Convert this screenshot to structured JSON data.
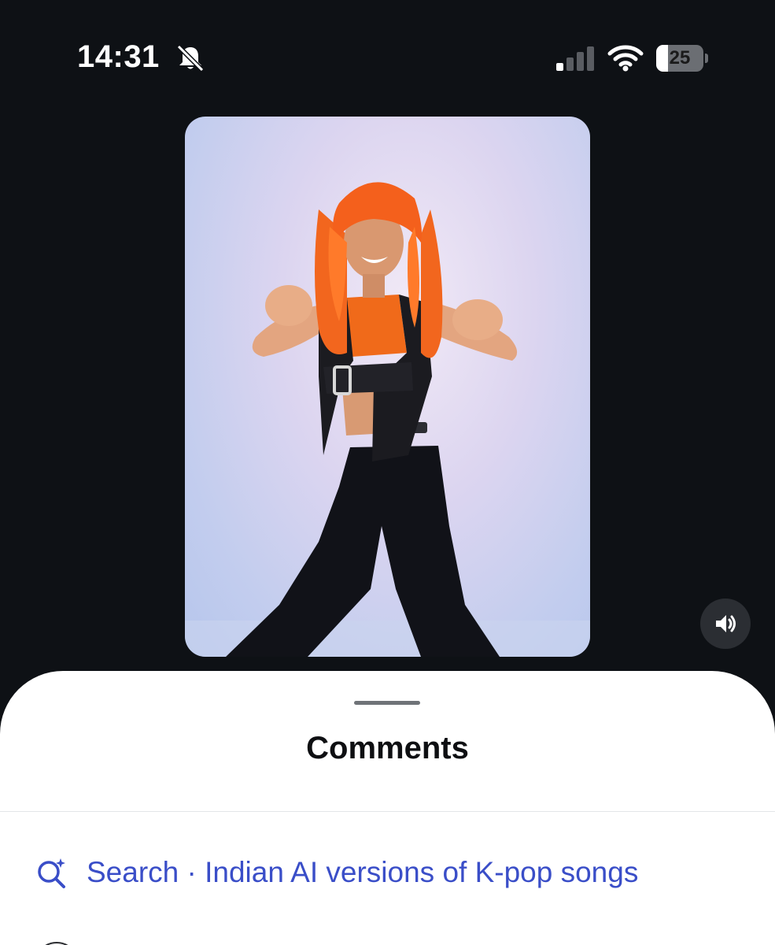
{
  "status_bar": {
    "time": "14:31",
    "silent_icon": "bell-slash-icon",
    "signal_icon": "cellular-signal-icon",
    "signal_bars_active": 1,
    "signal_bars_total": 4,
    "wifi_icon": "wifi-icon",
    "battery_icon": "battery-icon",
    "battery_level": "25"
  },
  "video": {
    "volume_icon": "speaker-volume-icon"
  },
  "comments_sheet": {
    "title": "Comments",
    "search_icon": "sparkle-search-icon",
    "search_suggestion": "Search · Indian AI versions of K-pop songs",
    "accent_color": "#3a4ec8"
  }
}
